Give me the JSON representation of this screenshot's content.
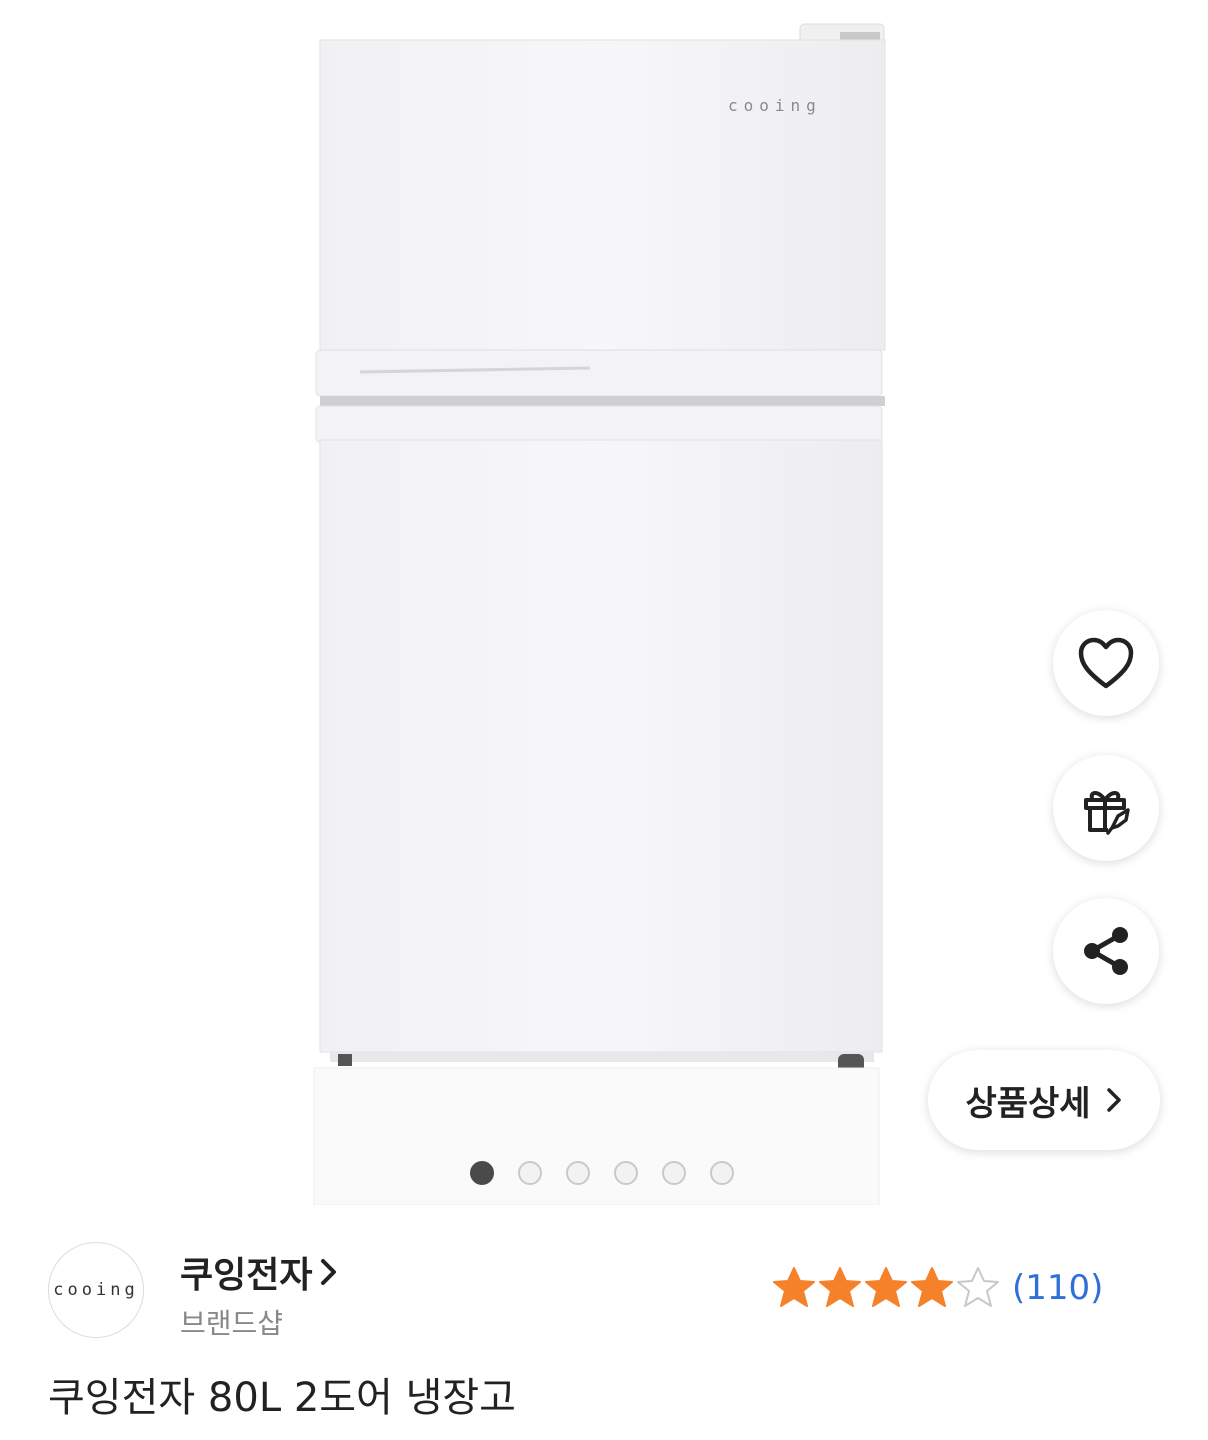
{
  "gallery": {
    "product_logo_text": "cooing",
    "slide_count": 6,
    "active_slide": 1
  },
  "actions": {
    "wishlist_icon": "heart-icon",
    "gift_icon": "gift-rocket-icon",
    "share_icon": "share-icon",
    "detail_label": "상품상세",
    "detail_icon": "chevron-right-icon"
  },
  "brand": {
    "logo_text": "cooing",
    "name": "쿠잉전자",
    "shop_label": "브랜드샵"
  },
  "rating": {
    "value": 4,
    "max": 5,
    "review_count": "(110)",
    "star_color": "#f5822a"
  },
  "product": {
    "title": "쿠잉전자 80L 2도어 냉장고"
  }
}
